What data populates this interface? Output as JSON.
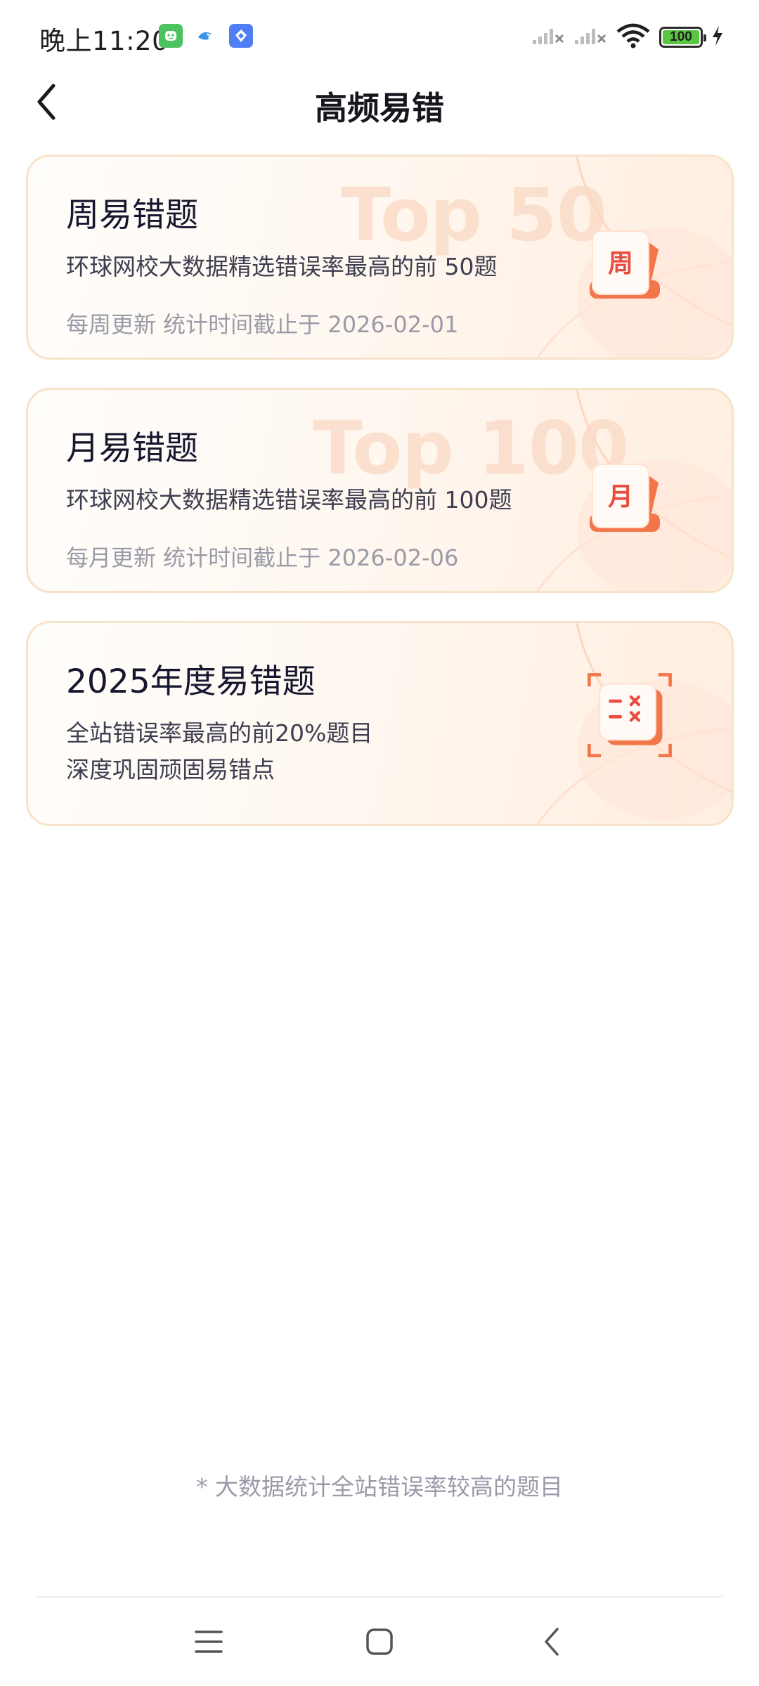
{
  "status_bar": {
    "time": "晚上11:20",
    "battery_level": "100",
    "app_icons": [
      "green-app-icon",
      "blue-fish-app-icon",
      "blue-app-icon"
    ]
  },
  "header": {
    "title": "高频易错"
  },
  "cards": [
    {
      "title": "周易错题",
      "description": "环球网校大数据精选错误率最高的前 50题",
      "meta": "每周更新  统计时间截止于 2026-02-01",
      "badge_text": "Top 50",
      "icon_char": "周"
    },
    {
      "title": "月易错题",
      "description": "环球网校大数据精选错误率最高的前 100题",
      "meta": "每月更新  统计时间截止于 2026-02-06",
      "badge_text": "Top 100",
      "icon_char": "月"
    },
    {
      "title": "2025年度易错题",
      "description": "全站错误率最高的前20%题目",
      "description2": "深度巩固顽固易错点"
    }
  ],
  "footnote": "* 大数据统计全站错误率较高的题目",
  "colors": {
    "accent": "#f3764a",
    "accent_light": "#ffd9c6",
    "card_border": "#f6e3c9",
    "title": "#16172f",
    "meta": "#9a9ba8"
  }
}
